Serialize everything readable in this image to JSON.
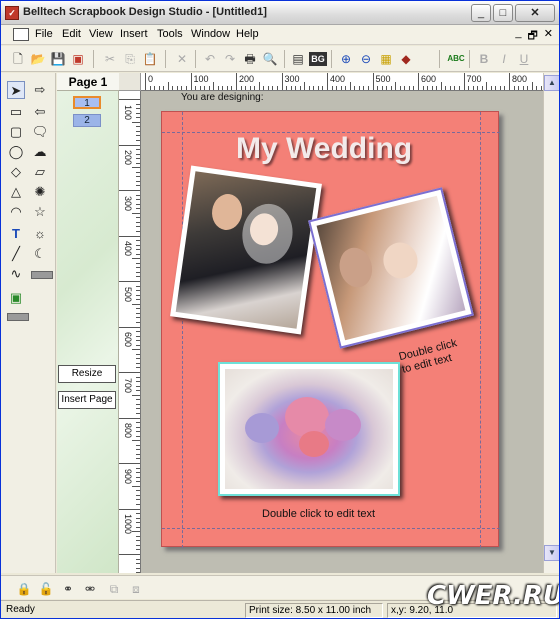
{
  "title": "Belltech Scrapbook Design Studio - [Untitled1]",
  "window_controls": {
    "minimize": "_",
    "maximize": "□",
    "close": "✕"
  },
  "menu": [
    "File",
    "Edit",
    "View",
    "Insert",
    "Tools",
    "Window",
    "Help"
  ],
  "mdi_controls": [
    "_",
    "🗗",
    "✕"
  ],
  "toolbar": {
    "icons": [
      "new-icon",
      "open-icon",
      "save-icon",
      "pdf-icon",
      "cut-icon",
      "copy-icon",
      "paste-icon",
      "delete-icon",
      "undo-icon",
      "redo-icon",
      "print-icon",
      "print-preview-icon",
      "page-setup-icon",
      "background-icon",
      "zoom-in-icon",
      "zoom-out-icon",
      "grid-icon",
      "library-icon",
      "spellcheck-icon",
      "bold-icon",
      "italic-icon",
      "underline-icon"
    ],
    "background_label": "BG",
    "spell_label": "ABC",
    "bold": "B",
    "italic": "I",
    "underline": "U"
  },
  "pages_panel": {
    "title": "Page 1",
    "pages": [
      "1",
      "2"
    ],
    "resize": "Resize",
    "insert_page": "Insert Page"
  },
  "ruler": {
    "top_labels": [
      "0",
      "100",
      "200",
      "300",
      "400",
      "500",
      "600",
      "700",
      "800"
    ],
    "left_labels": [
      "100",
      "200",
      "300",
      "400",
      "500",
      "600",
      "700",
      "800",
      "900",
      "1000"
    ]
  },
  "canvas": {
    "designing_label": "You are designing:",
    "heading": "My Wedding",
    "caption_rotated_line1": "Double click",
    "caption_rotated_line2": "to edit text",
    "caption_bottom": "Double click to edit text"
  },
  "status": {
    "ready": "Ready",
    "print_size": "Print size: 8.50 x 11.00 inch",
    "coords": "x,y: 9.20, 11.0"
  },
  "watermark": "CWER.RU",
  "colors": {
    "page": "#f48077",
    "frame_purple": "#7b6fd1",
    "frame_cyan": "#6ee0d8",
    "page_badge": "#e98b2c"
  }
}
